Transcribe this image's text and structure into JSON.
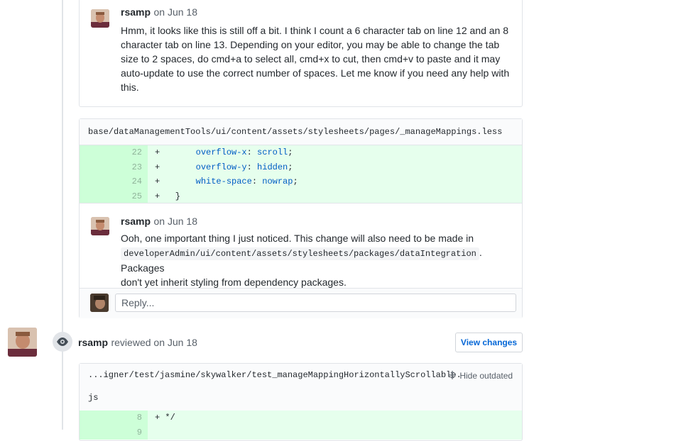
{
  "comment1": {
    "author": "rsamp",
    "date": "on Jun 18",
    "text": "Hmm, it looks like this is still off a bit. I think I count a 6 character tab on line 12 and an 8 character tab on line 13. Depending on your editor, you may be able to change the tab size to 2 spaces, do cmd+a to select all, cmd+x to cut, then cmd+v to paste and it may auto-update to use the correct number of spaces. Let me know if you need any help with this."
  },
  "diff1": {
    "file_path": "base/dataManagementTools/ui/content/assets/stylesheets/pages/_manageMappings.less",
    "lines": [
      {
        "num": "22",
        "sign": "+",
        "indent": "       ",
        "prop": "overflow-x",
        "value": "scroll"
      },
      {
        "num": "23",
        "sign": "+",
        "indent": "       ",
        "prop": "overflow-y",
        "value": "hidden"
      },
      {
        "num": "24",
        "sign": "+",
        "indent": "       ",
        "prop": "white-space",
        "value": "nowrap"
      },
      {
        "num": "25",
        "sign": "+",
        "code": "   }"
      }
    ]
  },
  "comment2": {
    "author": "rsamp",
    "date": "on Jun 18",
    "text_before": "Ooh, one important thing I just noticed. This change will also need to be made in",
    "code": "developerAdmin/ui/content/assets/stylesheets/packages/dataIntegration",
    "text_after": ". Packages",
    "text_line3": "don't yet inherit styling from dependency packages."
  },
  "reply": {
    "placeholder": "Reply..."
  },
  "review": {
    "author": "rsamp",
    "action": "reviewed on Jun 18",
    "view_changes_label": "View changes",
    "file_path_line1": "...igner/test/jasmine/skywalker/test_manageMappingHorizontallyScrollable.",
    "file_path_line2": "js",
    "hide_outdated_label": "Hide outdated",
    "lines": [
      {
        "num": "8",
        "sign": "+",
        "code": " */"
      },
      {
        "num": "9",
        "sign": "",
        "code": ""
      }
    ]
  },
  "colors": {
    "link": "#0366d6",
    "addition_bg": "#e6ffed",
    "addition_num_bg": "#cdffd8",
    "keyword": "#005cc5"
  },
  "icons": [
    "avatar",
    "eye-icon",
    "fold-icon"
  ]
}
